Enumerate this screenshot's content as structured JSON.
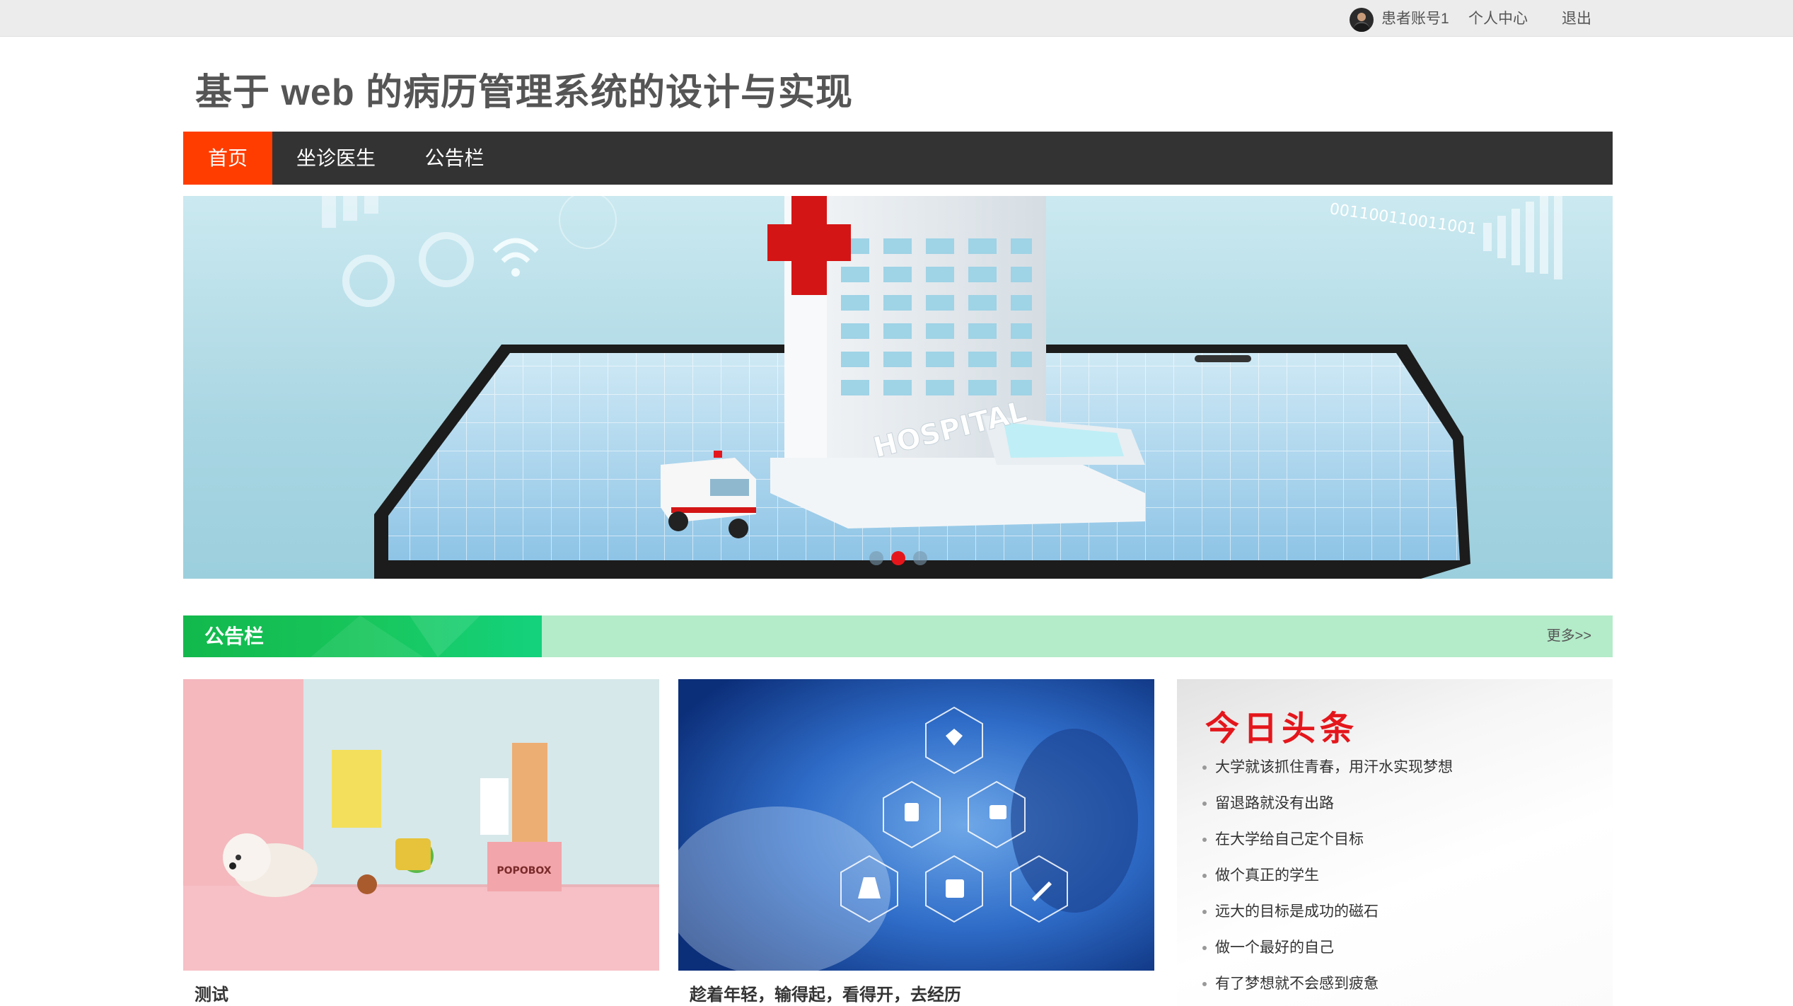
{
  "topbar": {
    "username": "患者账号1",
    "profile_label": "个人中心",
    "logout_label": "退出"
  },
  "site": {
    "title": "基于 web 的病历管理系统的设计与实现"
  },
  "nav": {
    "items": [
      {
        "label": "首页",
        "active": true
      },
      {
        "label": "坐诊医生",
        "active": false
      },
      {
        "label": "公告栏",
        "active": false
      }
    ]
  },
  "banner": {
    "building_text": "HOSPITAL",
    "binary_text": "001100110011001",
    "slides": 3,
    "active_slide": 2
  },
  "notice_section": {
    "title": "公告栏",
    "more_label": "更多>>"
  },
  "cards": [
    {
      "title": "测试",
      "image_text": "POPOBOX"
    },
    {
      "title": "趁着年轻，输得起，看得开，去经历"
    }
  ],
  "headlines": {
    "title": "今日头条",
    "items": [
      "大学就该抓住青春，用汗水实现梦想",
      "留退路就没有出路",
      "在大学给自己定个目标",
      "做个真正的学生",
      "远大的目标是成功的磁石",
      "做一个最好的自己",
      "有了梦想就不会感到疲惫"
    ]
  },
  "colors": {
    "nav_bg": "#333333",
    "nav_active": "#ff3d00",
    "section_green": "#18c75e",
    "section_light": "#b4ebc9",
    "headline_red": "#e4161b"
  }
}
